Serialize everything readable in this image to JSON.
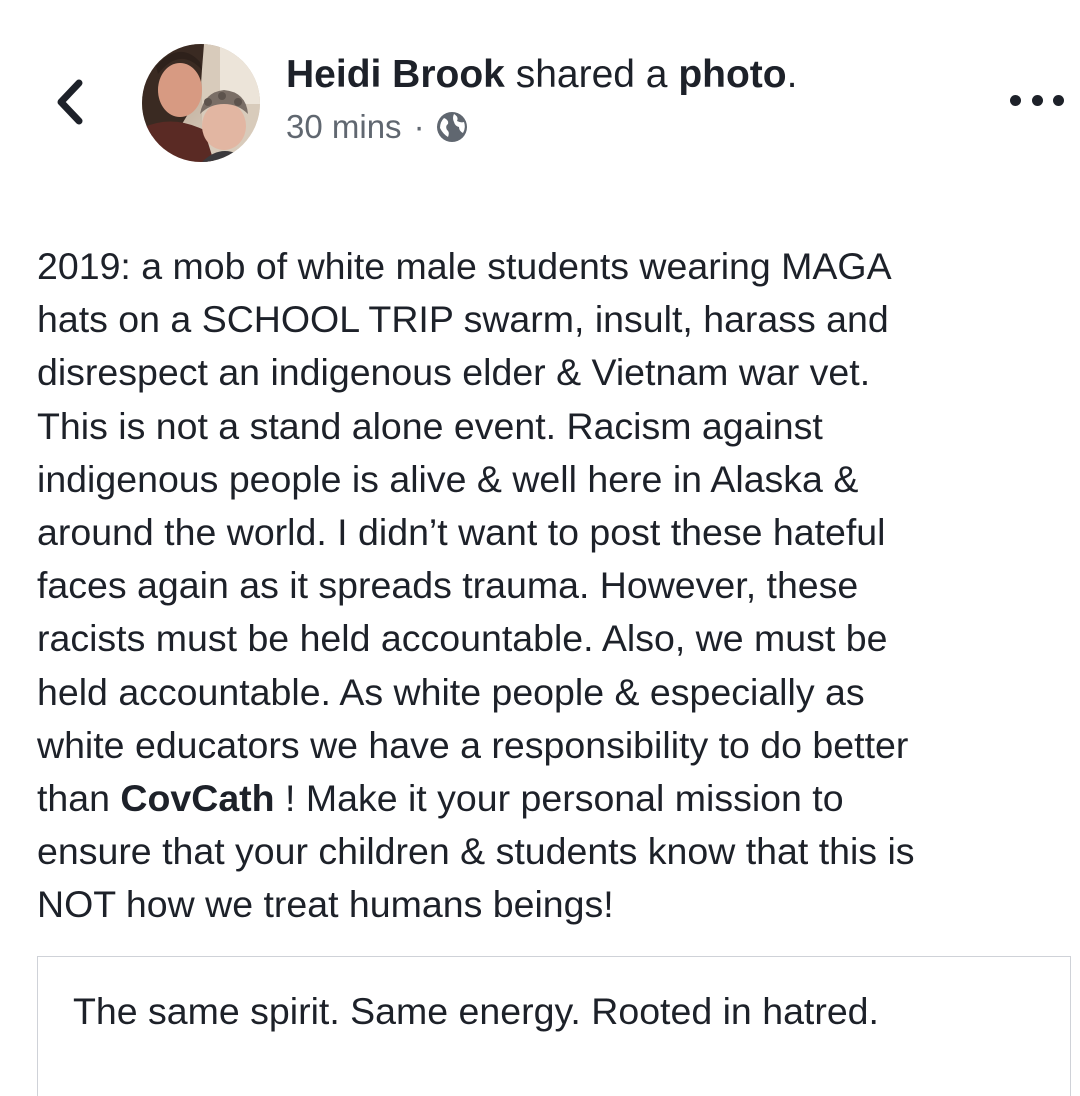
{
  "header": {
    "author_name": "Heidi Brook",
    "action_text": " shared a ",
    "object_text": "photo",
    "trailing": ".",
    "timestamp": "30 mins",
    "separator": "·",
    "privacy_icon": "globe-icon",
    "back_icon": "chevron-left-icon",
    "more_icon": "more-horizontal-icon"
  },
  "post": {
    "text_before_mention": "2019: a mob of white male students wearing MAGA\nhats on a SCHOOL TRIP swarm, insult, harass and\ndisrespect an indigenous elder & Vietnam war vet.\nThis is not a stand alone event. Racism against\nindigenous people is alive & well here in Alaska &\naround the world. I didn’t want to post these hateful\nfaces again as it spreads trauma. However, these\nracists must be held accountable. Also, we must be\nheld accountable. As white people & especially as\nwhite educators we have a responsibility to do better\nthan ",
    "mention": "CovCath",
    "text_after_mention": " ! Make it your personal mission to\nensure that your children & students know that this is\nNOT how we treat humans beings!"
  },
  "photo": {
    "caption": "The same spirit. Same energy. Rooted in hatred."
  },
  "colors": {
    "text": "#1d2129",
    "secondary_text": "#606770",
    "card_border": "#cfd2d8"
  }
}
